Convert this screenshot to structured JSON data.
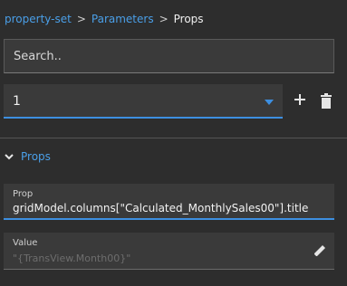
{
  "breadcrumb": {
    "items": [
      "property-set",
      "Parameters"
    ],
    "separator": ">",
    "current": "Props"
  },
  "search": {
    "placeholder": "Search.."
  },
  "selector": {
    "value": "1",
    "icon": "chevron-down-icon"
  },
  "actions": {
    "add_icon": "plus-icon",
    "delete_icon": "trash-icon"
  },
  "section": {
    "label": "Props",
    "expanded": true
  },
  "prop_field": {
    "label": "Prop",
    "value": "gridModel.columns[\"Calculated_MonthlySales00\"].title"
  },
  "value_field": {
    "label": "Value",
    "placeholder": "\"{TransView.Month00}\"",
    "icon": "pencil-icon"
  },
  "colors": {
    "accent": "#3d8fe0",
    "link": "#4a9fe8",
    "background": "#2d2d2d",
    "field": "#3a3a3a"
  }
}
